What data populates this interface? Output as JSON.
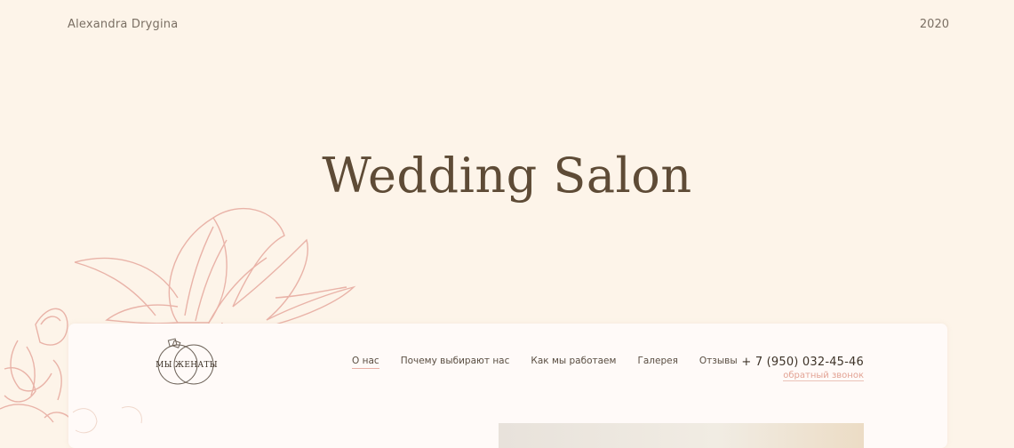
{
  "header": {
    "author": "Alexandra Drygina",
    "year": "2020"
  },
  "hero": {
    "title": "Wedding Salon"
  },
  "site_preview": {
    "logo_text": "МЫ ЖЕНАТЫ",
    "nav": [
      {
        "label": "О нас",
        "active": true
      },
      {
        "label": "Почему выбирают нас",
        "active": false
      },
      {
        "label": "Как мы работаем",
        "active": false
      },
      {
        "label": "Галерея",
        "active": false
      },
      {
        "label": "Отзывы",
        "active": false
      }
    ],
    "phone": "+ 7 (950) 032-45-46",
    "callback_label": "обратный звонок"
  },
  "colors": {
    "background": "#fdf4e9",
    "title": "#5e4b36",
    "floral_outline": "#e9b3a8",
    "accent": "#e2a394"
  }
}
